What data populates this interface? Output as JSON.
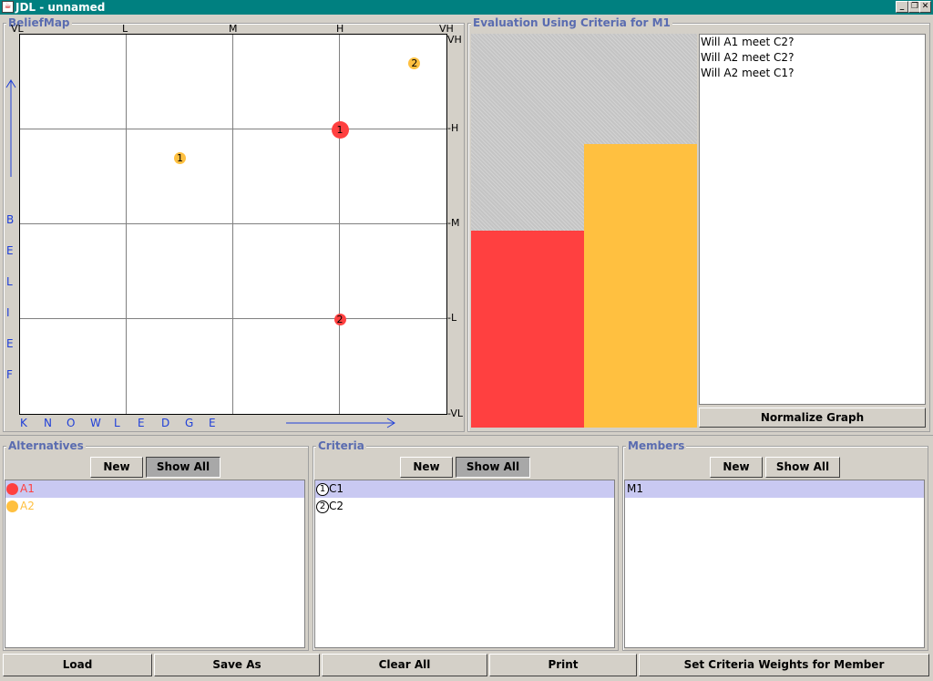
{
  "window": {
    "title": "JDL - unnamed",
    "min_label": "_",
    "max_label": "❐",
    "close_label": "✕",
    "icon_glyph": "☕"
  },
  "belief_map": {
    "title": "BeliefMap",
    "top_ticks": [
      "VL",
      "L",
      "M",
      "H",
      "VH"
    ],
    "right_ticks": [
      "VH",
      "-H",
      "-M",
      "-L",
      "-VL"
    ],
    "y_axis_letters": [
      "B",
      "E",
      "L",
      "I",
      "E",
      "F"
    ],
    "x_axis_letters": [
      "K",
      "N",
      "O",
      "W",
      "L",
      "E",
      "D",
      "G",
      "E"
    ],
    "points": [
      {
        "label": "1",
        "alternative": "A2",
        "color": "#ffc040",
        "knowledge": 1.5,
        "belief": 2.7
      },
      {
        "label": "2",
        "alternative": "A2",
        "color": "#ffc040",
        "knowledge": 3.7,
        "belief": 3.7
      },
      {
        "label": "1",
        "alternative": "A1",
        "color": "#ff4040",
        "knowledge": 3.0,
        "belief": 3.0
      },
      {
        "label": "2",
        "alternative": "A1",
        "color": "#ff4040",
        "knowledge": 3.0,
        "belief": 1.0
      }
    ]
  },
  "evaluation": {
    "title": "Evaluation Using Criteria for M1",
    "bars": [
      {
        "alternative": "A1",
        "color": "#ff4040",
        "value": 0.5
      },
      {
        "alternative": "A2",
        "color": "#ffc040",
        "value": 0.72
      }
    ],
    "questions": [
      "Will A1 meet C2?",
      "Will A2 meet C2?",
      "Will A2 meet C1?"
    ],
    "normalize_label": "Normalize Graph"
  },
  "alternatives": {
    "title": "Alternatives",
    "new_label": "New",
    "show_all_label": "Show All",
    "items": [
      {
        "label": "A1",
        "color": "#ff4040"
      },
      {
        "label": "A2",
        "color": "#ffc040"
      }
    ]
  },
  "criteria": {
    "title": "Criteria",
    "new_label": "New",
    "show_all_label": "Show All",
    "items": [
      {
        "num": "1",
        "label": "C1"
      },
      {
        "num": "2",
        "label": "C2"
      }
    ]
  },
  "members": {
    "title": "Members",
    "new_label": "New",
    "show_all_label": "Show All",
    "items": [
      {
        "label": "M1"
      }
    ]
  },
  "toolbar": {
    "load_label": "Load",
    "save_as_label": "Save As",
    "clear_all_label": "Clear All",
    "print_label": "Print",
    "set_weights_label": "Set Criteria Weights for Member"
  }
}
